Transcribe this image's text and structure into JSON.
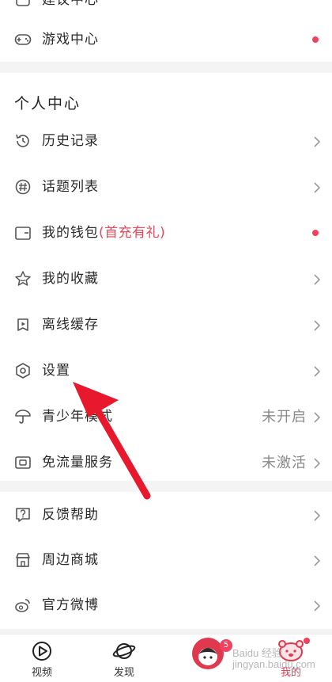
{
  "top_section": {
    "partial_item_label": "建议中心",
    "game_center": {
      "label": "游戏中心",
      "icon": "gamepad-icon",
      "has_dot": true
    }
  },
  "personal_center": {
    "title": "个人中心",
    "items": [
      {
        "label": "历史记录",
        "icon": "history-clock-icon"
      },
      {
        "label": "话题列表",
        "icon": "hashtag-icon"
      },
      {
        "label": "我的钱包",
        "promo": "(首充有礼)",
        "icon": "wallet-icon",
        "has_dot": true
      },
      {
        "label": "我的收藏",
        "icon": "star-icon"
      },
      {
        "label": "离线缓存",
        "icon": "download-play-icon"
      },
      {
        "label": "设置",
        "icon": "settings-hexagon-icon"
      },
      {
        "label": "青少年模式",
        "value": "未开启",
        "icon": "umbrella-icon"
      },
      {
        "label": "免流量服务",
        "value": "未激活",
        "icon": "data-card-icon"
      }
    ]
  },
  "misc_section": {
    "items": [
      {
        "label": "反馈帮助",
        "icon": "help-question-icon"
      },
      {
        "label": "周边商城",
        "icon": "shop-icon"
      },
      {
        "label": "官方微博",
        "icon": "weibo-icon"
      }
    ]
  },
  "tabbar": {
    "tabs": [
      {
        "label": "视频",
        "icon": "video-play-icon"
      },
      {
        "label": "发现",
        "icon": "planet-icon"
      },
      {
        "label": "",
        "icon": "avatar-icon",
        "badge": "5"
      },
      {
        "label": "我的",
        "icon": "profile-mascot-icon",
        "active": true
      }
    ]
  },
  "colors": {
    "accent": "#f2405d",
    "promo_text": "#e9475b",
    "annotation_arrow": "#e8192c"
  },
  "watermark": "Baidu 经验 jingyan.baidu.com"
}
